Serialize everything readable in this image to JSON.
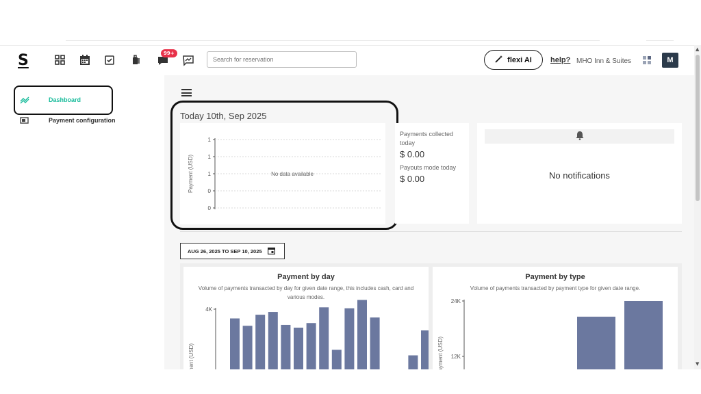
{
  "header": {
    "logo": "S",
    "search_placeholder": "Search for reservation",
    "notification_badge": "99+",
    "flexi_label": "flexi AI",
    "help_label": "help?",
    "hotel_name": "MHO Inn & Suites",
    "avatar_initial": "M"
  },
  "sidebar": {
    "items": [
      {
        "label": "Dashboard",
        "icon": "dashboard-icon",
        "active": true
      },
      {
        "label": "Payment configuration",
        "icon": "payment-config-icon",
        "active": false
      }
    ]
  },
  "today": {
    "title": "Today 10th, Sep 2025",
    "no_data": "No data available",
    "payments_collected_label": "Payments collected today",
    "payments_collected_value": "$ 0.00",
    "payouts_label": "Payouts mode today",
    "payouts_value": "$ 0.00"
  },
  "notifications": {
    "empty_text": "No notifications"
  },
  "date_range": {
    "label": "AUG 26, 2025 TO SEP 10, 2025"
  },
  "chart_data": [
    {
      "type": "line",
      "ylabel": "Payment (USD)",
      "yticks": [
        "1",
        "1",
        "1",
        "0",
        "0"
      ],
      "series": [],
      "annotation": "No data available",
      "grid": true
    },
    {
      "type": "bar",
      "title": "Payment by day",
      "subtitle": "Volume of payments transacted by day for given date range, this includes cash, card and various modes.",
      "ylabel": "Payment (USD)",
      "yticks": [
        "4K"
      ],
      "values": [
        3500,
        3100,
        3700,
        3850,
        3150,
        3000,
        3250,
        4100,
        1800,
        4050,
        4500,
        3550,
        0,
        0,
        1500,
        2850
      ],
      "color": "#6b789f"
    },
    {
      "type": "bar",
      "title": "Payment by type",
      "subtitle": "Volume of payments transacted by payment type for given date range.",
      "ylabel": "Payment (USD)",
      "yticks": [
        "24K",
        "12K"
      ],
      "values": [
        0,
        0,
        20600,
        24000
      ],
      "color": "#6b789f"
    }
  ],
  "colors": {
    "accent": "#1abc9c",
    "bar": "#6b789f",
    "badge": "#e8324a",
    "avatar_bg": "#2b3a4a"
  }
}
